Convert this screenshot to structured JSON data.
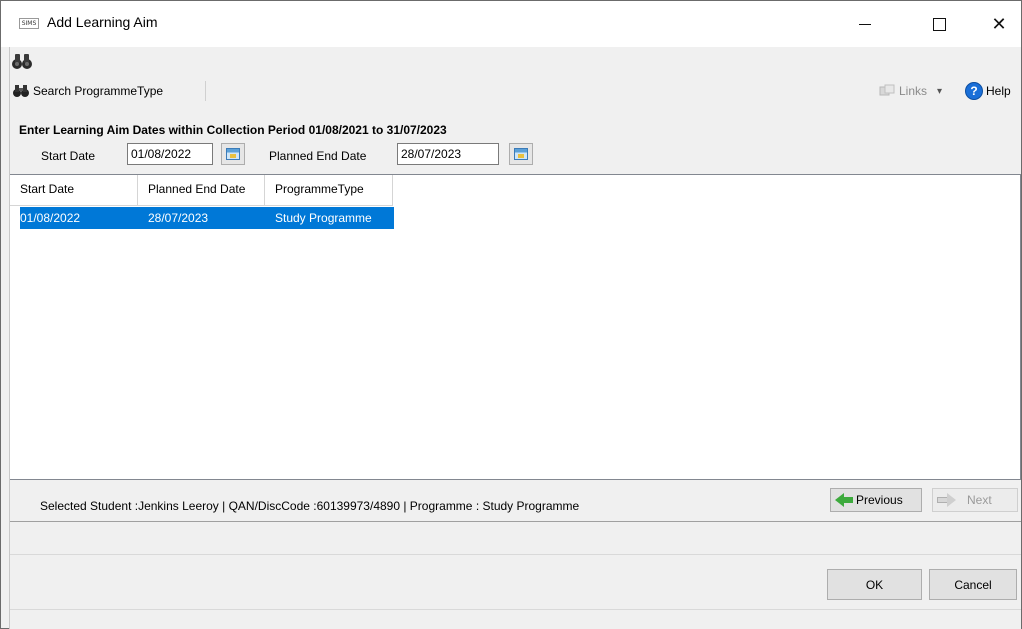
{
  "window": {
    "app_icon_text": "SIMS",
    "title": "Add Learning Aim",
    "minimize_glyph": "—",
    "maximize_glyph": "☐",
    "close_glyph": "✕"
  },
  "toolbar": {
    "search_label": "Search ProgrammeType",
    "links_label": "Links",
    "links_caret": "▾",
    "help_label": "Help",
    "help_glyph": "?"
  },
  "dates": {
    "heading": "Enter Learning Aim Dates within Collection Period 01/08/2021 to 31/07/2023",
    "start_label": "Start Date",
    "start_value": "01/08/2022",
    "end_label": "Planned End Date",
    "end_value": "28/07/2023"
  },
  "grid": {
    "columns": [
      "Start Date",
      "Planned End Date",
      "ProgrammeType"
    ],
    "rows": [
      [
        "01/08/2022",
        "28/07/2023",
        "Study Programme"
      ]
    ]
  },
  "info": {
    "text": "Selected Student :Jenkins Leeroy  | QAN/DiscCode :60139973/4890  | Programme : Study Programme",
    "previous_label": "Previous",
    "next_label": "Next"
  },
  "footer": {
    "ok_label": "OK",
    "cancel_label": "Cancel"
  },
  "colors": {
    "selection": "#0078d7",
    "help_blue": "#1a6fd8",
    "arrow_green": "#3daa3d"
  },
  "icons": {
    "binoculars": "binoculars-icon",
    "calendar": "calendar-icon",
    "links": "links-icon",
    "help": "help-icon",
    "previous": "left-arrow-icon",
    "next": "right-arrow-icon"
  }
}
